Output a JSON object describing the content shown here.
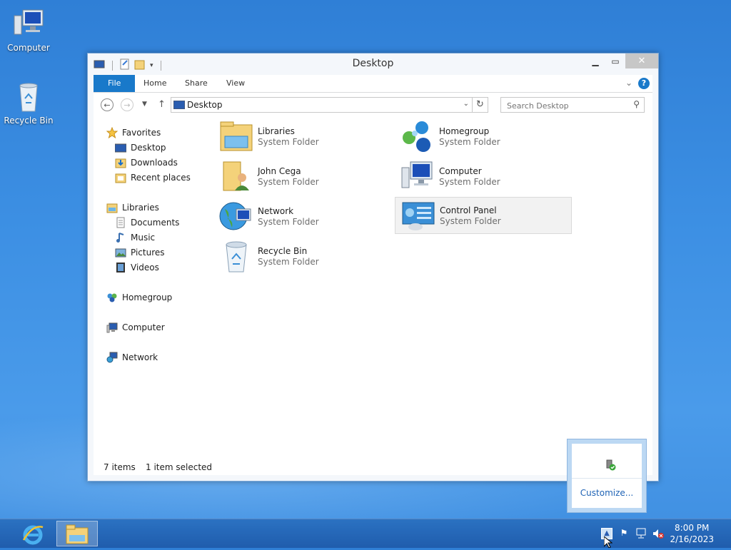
{
  "desktop": {
    "icons": [
      {
        "label": "Computer",
        "icon": "computer-icon"
      },
      {
        "label": "Recycle Bin",
        "icon": "recycle-bin-icon"
      }
    ]
  },
  "window": {
    "title": "Desktop",
    "ribbon_tabs": [
      "File",
      "Home",
      "Share",
      "View"
    ],
    "address": "Desktop",
    "search_placeholder": "Search Desktop",
    "nav": {
      "favorites": "Favorites",
      "favorites_items": [
        "Desktop",
        "Downloads",
        "Recent places"
      ],
      "libraries": "Libraries",
      "libraries_items": [
        "Documents",
        "Music",
        "Pictures",
        "Videos"
      ],
      "homegroup": "Homegroup",
      "computer": "Computer",
      "network": "Network"
    },
    "items": [
      {
        "name": "Libraries",
        "type": "System Folder",
        "icon": "libraries-folder-icon"
      },
      {
        "name": "Homegroup",
        "type": "System Folder",
        "icon": "homegroup-icon"
      },
      {
        "name": "John Cega",
        "type": "System Folder",
        "icon": "user-folder-icon"
      },
      {
        "name": "Computer",
        "type": "System Folder",
        "icon": "computer-icon"
      },
      {
        "name": "Network",
        "type": "System Folder",
        "icon": "network-globe-icon"
      },
      {
        "name": "Control Panel",
        "type": "System Folder",
        "icon": "control-panel-icon"
      },
      {
        "name": "Recycle Bin",
        "type": "System Folder",
        "icon": "recycle-bin-icon"
      }
    ],
    "status": {
      "count": "7 items",
      "selected": "1 item selected"
    }
  },
  "tray_overflow": {
    "customize": "Customize..."
  },
  "taskbar": {
    "time": "8:00 PM",
    "date": "2/16/2023"
  },
  "colors": {
    "accent": "#1979ca",
    "desktop": "#3c8fe3",
    "selection": "#f2f2f2"
  }
}
